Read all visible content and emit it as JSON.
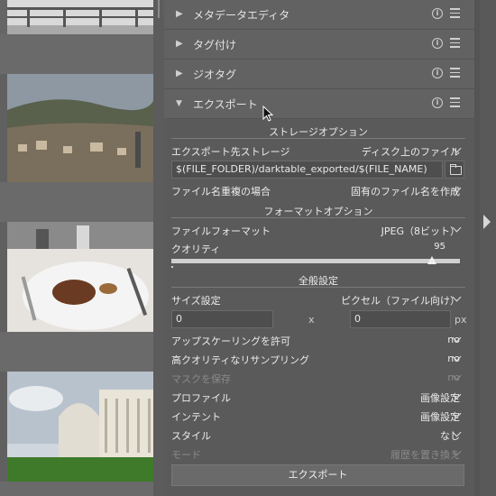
{
  "modules": {
    "metadata": {
      "label": "メタデータエディタ"
    },
    "tagging": {
      "label": "タグ付け"
    },
    "geotag": {
      "label": "ジオタグ"
    },
    "export": {
      "label": "エクスポート"
    }
  },
  "storage": {
    "section_title": "ストレージオプション",
    "target_label": "エクスポート先ストレージ",
    "target_value": "ディスク上のファイル",
    "path_value": "$(FILE_FOLDER)/darktable_exported/$(FILE_NAME)",
    "conflict_label": "ファイル名重複の場合",
    "conflict_value": "固有のファイル名を作成"
  },
  "format": {
    "section_title": "フォーマットオプション",
    "format_label": "ファイルフォーマット",
    "format_value": "JPEG（8ビット）",
    "quality_label": "クオリティ",
    "quality_value": "95"
  },
  "global": {
    "section_title": "全般設定",
    "size_label": "サイズ設定",
    "size_value": "ピクセル（ファイル向け）",
    "width_value": "0",
    "height_value": "0",
    "times": "x",
    "unit": "px",
    "upscale_label": "アップスケーリングを許可",
    "upscale_value": "no",
    "hq_label": "高クオリティなリサンプリング",
    "hq_value": "no",
    "masks_label": "マスクを保存",
    "masks_value": "no",
    "profile_label": "プロファイル",
    "profile_value": "画像設定",
    "intent_label": "インテント",
    "intent_value": "画像設定",
    "style_label": "スタイル",
    "style_value": "なし",
    "mode_label": "モード",
    "mode_value": "履歴を置き換え"
  },
  "export_button": "エクスポート",
  "colors": {
    "panel_bg": "#5a5a5a",
    "header_bg": "#626262",
    "input_bg": "#4e4e4e",
    "text": "#ececec",
    "disabled_text": "#8a8a8a"
  }
}
